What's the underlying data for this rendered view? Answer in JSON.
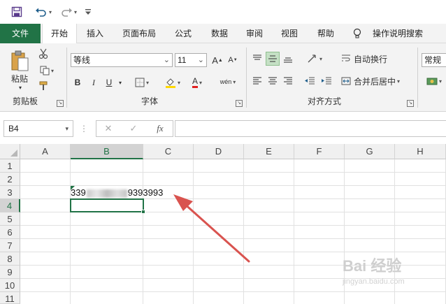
{
  "ribbon_tabs": [
    "文件",
    "开始",
    "插入",
    "页面布局",
    "公式",
    "数据",
    "审阅",
    "视图",
    "帮助",
    "操作说明搜索"
  ],
  "ribbon": {
    "clipboard": {
      "paste_label": "粘贴",
      "group_label": "剪贴板"
    },
    "font": {
      "font_name": "等线",
      "font_size": "11",
      "grow": "A",
      "shrink": "A",
      "bold": "B",
      "italic": "I",
      "underline": "U",
      "font_color_letter": "A",
      "phonetic": "wén",
      "group_label": "字体"
    },
    "alignment": {
      "wrap_text": "自动换行",
      "merge_center": "合并后居中",
      "group_label": "对齐方式"
    },
    "number": {
      "format": "常规"
    }
  },
  "formula_bar": {
    "name_box": "B4",
    "fx": "fx",
    "cancel": "✕",
    "enter": "✓",
    "formula": ""
  },
  "grid": {
    "columns": [
      "A",
      "B",
      "C",
      "D",
      "E",
      "F",
      "G",
      "H"
    ],
    "rows": [
      "1",
      "2",
      "3",
      "4",
      "5",
      "6",
      "7",
      "8",
      "9",
      "10",
      "11"
    ],
    "selected_cell": "B4",
    "cell_b3_prefix": "339",
    "cell_b3_suffix": "9393993"
  },
  "watermark": {
    "text": "Bai 经验",
    "sub": "jingyan.baidu.com"
  },
  "colors": {
    "accent": "#217346",
    "arrow": "#d9534f"
  }
}
